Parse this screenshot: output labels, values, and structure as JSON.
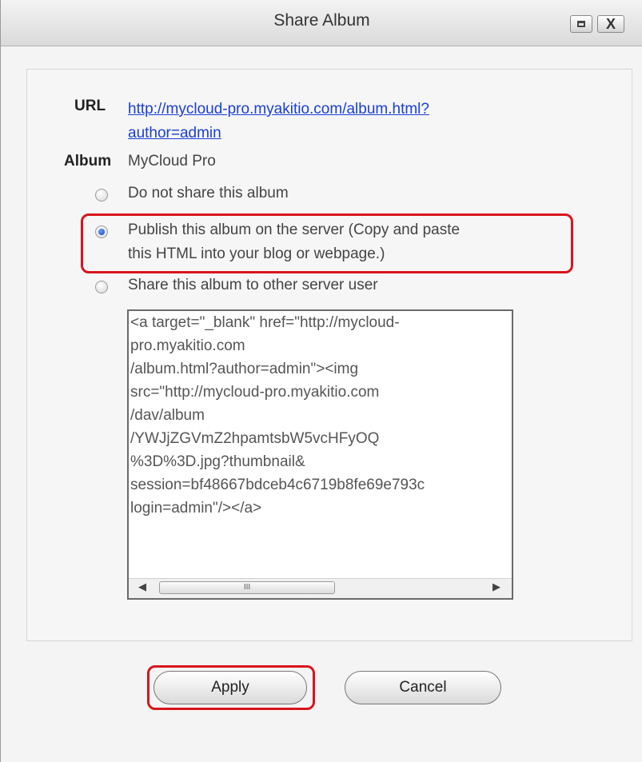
{
  "window": {
    "title": "Share Album",
    "controls": [
      "maximize-icon",
      "close-icon"
    ],
    "close_glyph": "X"
  },
  "form": {
    "url_label": "URL",
    "url_value": "http://mycloud-pro.myakitio.com/album.html?author=admin",
    "album_label": "Album",
    "album_value": "MyCloud Pro"
  },
  "share_options": {
    "selected": 1,
    "items": [
      {
        "label": "Do not share this album"
      },
      {
        "label": "Publish this album on the server (Copy and paste",
        "label2": "this HTML into your blog or webpage.)"
      },
      {
        "label": "Share this album to other server user"
      }
    ]
  },
  "html_code": {
    "lines": [
      "<a target=\"_blank\" href=\"http://mycloud-",
      "pro.myakitio.com",
      "/album.html?author=admin\"><img",
      "src=\"http://mycloud-pro.myakitio.com",
      "/dav/album",
      "/YWJjZGVmZ2hpamtsbW5vcHFyOQ",
      "%3D%3D.jpg?thumbnail&",
      "session=bf48667bdceb4c6719b8fe69e793c",
      "login=admin\"/></a>"
    ],
    "scroll_thumb_glyph": "III"
  },
  "buttons": {
    "apply": "Apply",
    "cancel": "Cancel"
  },
  "colors": {
    "highlight": "#d8141c",
    "link": "#1a3fd6"
  }
}
